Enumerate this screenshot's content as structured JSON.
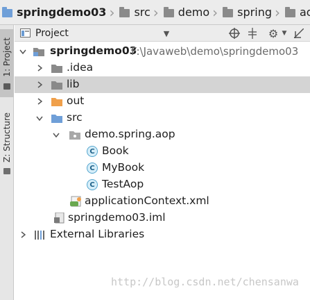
{
  "breadcrumb": [
    {
      "label": "springdemo03",
      "icon": "project-folder-icon"
    },
    {
      "label": "src",
      "icon": "folder-icon"
    },
    {
      "label": "demo",
      "icon": "folder-icon"
    },
    {
      "label": "spring",
      "icon": "folder-icon"
    },
    {
      "label": "aop",
      "icon": "folder-icon"
    }
  ],
  "toolstrip": {
    "project_tab": "1: Project",
    "structure_tab": "Z: Structure"
  },
  "panel": {
    "title": "Project",
    "buttons": [
      "target-icon",
      "collapse-all-icon",
      "gear-icon",
      "hide-icon"
    ]
  },
  "tree": {
    "root": {
      "name": "springdemo03",
      "path": "F:\\Javaweb\\demo\\springdemo03"
    },
    "idea": ".idea",
    "lib": "lib",
    "out": "out",
    "src": "src",
    "package": "demo.spring.aop",
    "classes": [
      "Book",
      "MyBook",
      "TestAop"
    ],
    "xml": "applicationContext.xml",
    "iml": "springdemo03.iml",
    "external": "External Libraries"
  },
  "watermark": "http://blog.csdn.net/chensanwa",
  "colors": {
    "folder": "#8a8a8a",
    "out_folder": "#f0a04b",
    "source_folder": "#6f9fd8",
    "class_badge": "#55a6cf",
    "selection": "#d4d4d4"
  }
}
